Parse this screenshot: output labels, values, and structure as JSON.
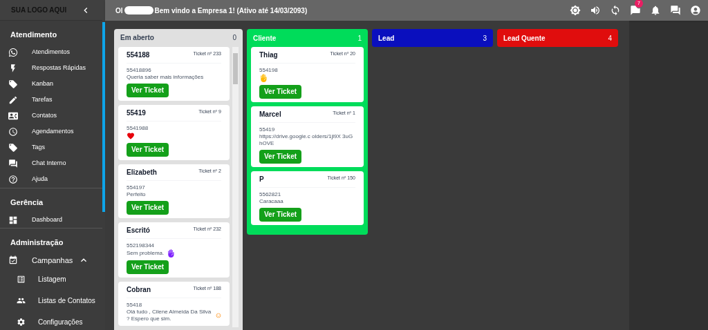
{
  "sidebar": {
    "logo": "SUA LOGO AQUI",
    "sections": [
      {
        "title": "Atendimento",
        "items": [
          {
            "label": "Atendimentos"
          },
          {
            "label": "Respostas Rápidas"
          },
          {
            "label": "Kanban"
          },
          {
            "label": "Tarefas"
          },
          {
            "label": "Contatos"
          },
          {
            "label": "Agendamentos"
          },
          {
            "label": "Tags"
          },
          {
            "label": "Chat Interno"
          },
          {
            "label": "Ajuda"
          }
        ]
      },
      {
        "title": "Gerência",
        "items": [
          {
            "label": "Dashboard"
          }
        ]
      },
      {
        "title": "Administração",
        "items": [
          {
            "label": "Campanhas",
            "expanded": true,
            "children": [
              {
                "label": "Listagem"
              },
              {
                "label": "Listas de Contatos"
              },
              {
                "label": "Configurações"
              }
            ]
          }
        ]
      }
    ]
  },
  "header": {
    "greeting_start": "Ol",
    "greeting_end": "Bem vindo a Empresa 1! (Ativo até 14/03/2093)",
    "notification_count": "7"
  },
  "columns": [
    {
      "title": "Em aberto",
      "count": "0",
      "color": "#e0e0e0",
      "cards": [
        {
          "kind": "plain",
          "name": "554188",
          "ticket": "Ticket nº 233",
          "phone": "55418896",
          "message": "Queria saber mais informações",
          "button": "Ver Ticket"
        },
        {
          "kind": "heart",
          "name": "55419",
          "ticket": "Ticket nº 9",
          "phone": "5541988",
          "button": "Ver Ticket"
        },
        {
          "kind": "plain",
          "name": "Elizabeth",
          "ticket": "Ticket nº 2",
          "phone": "554197",
          "message": "Perfeito",
          "button": "Ver Ticket"
        },
        {
          "kind": "pray",
          "name": "Escritó",
          "ticket": "Ticket nº 232",
          "phone": "552198344",
          "message": "Sem problema.",
          "button": "Ver Ticket"
        },
        {
          "kind": "smile",
          "name": "Cobran",
          "ticket": "Ticket nº 188",
          "phone": "55418",
          "message": "Olá tudo , Cilene Almeida Da Silva ? Espero que sim."
        }
      ]
    },
    {
      "title": "Cliente",
      "count": "1",
      "color": "#00dc5a",
      "cards": [
        {
          "kind": "raised-hands",
          "name": "Thiag",
          "ticket": "Ticket nº 20",
          "phone": "554198",
          "button": "Ver Ticket"
        },
        {
          "kind": "plain",
          "name": "Marcel",
          "ticket": "Ticket nº 1",
          "phone": "55419",
          "message": "https://drive.google.c olders/1jl9X 3uGhOVE",
          "button": "Ver Ticket"
        },
        {
          "kind": "plain",
          "name": "P",
          "ticket": "Ticket nº 150",
          "phone": "5562821",
          "message": "Caracaaa",
          "button": "Ver Ticket"
        }
      ]
    },
    {
      "title": "Lead",
      "count": "3",
      "color": "#0a0fbe"
    },
    {
      "title": "Lead Quente",
      "count": "4",
      "color": "#e00d0d"
    }
  ]
}
